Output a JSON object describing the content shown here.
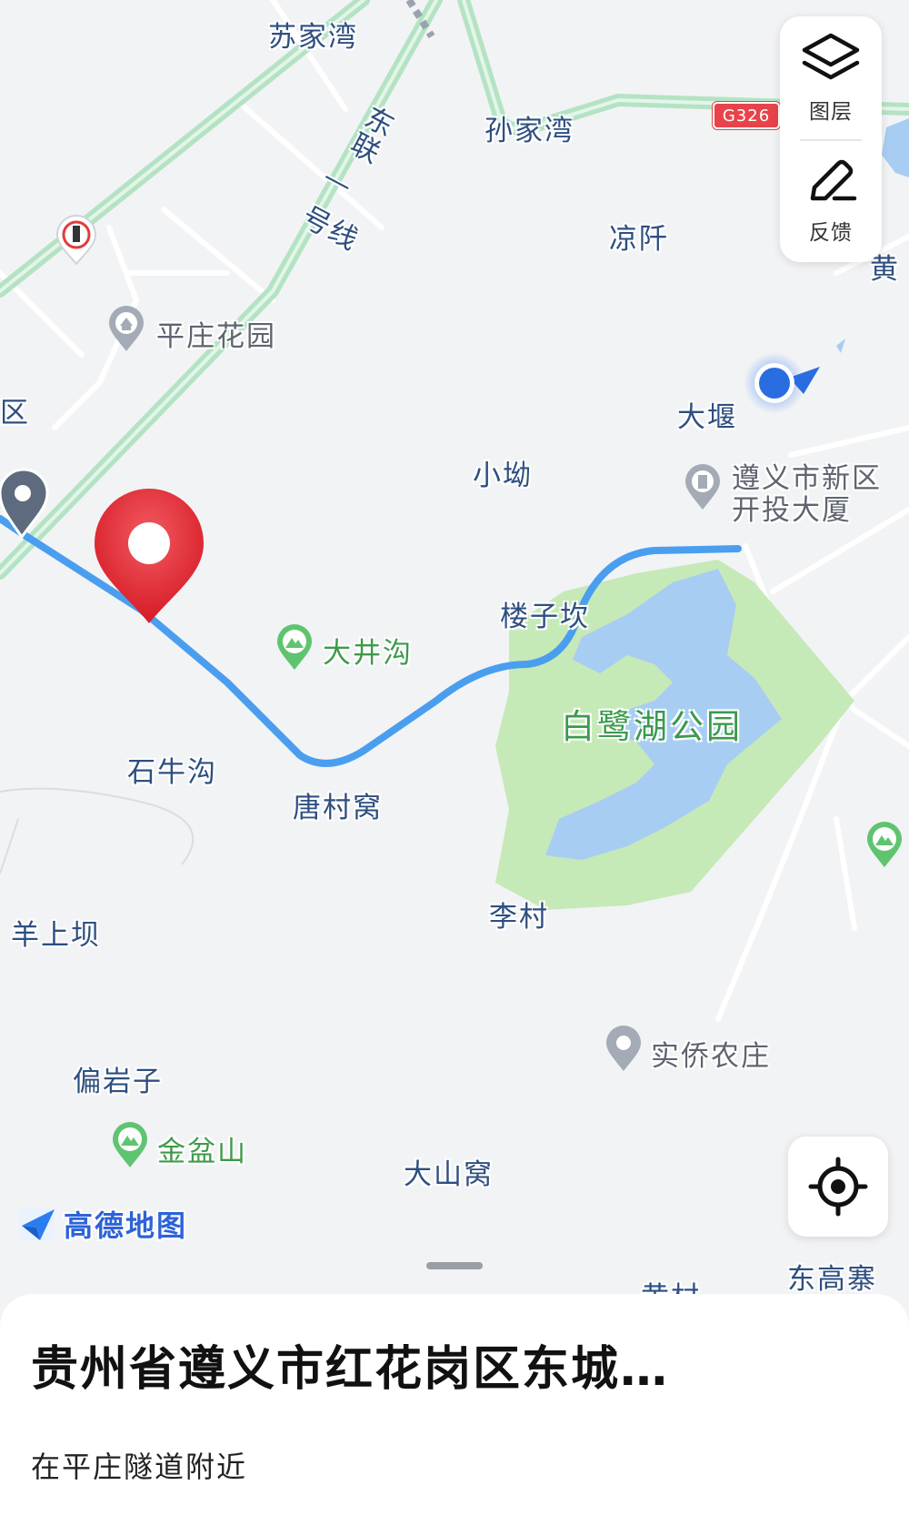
{
  "map": {
    "labels": {
      "sujiawan": "苏家湾",
      "sunjiawan": "孙家湾",
      "liangqian": "凉阡",
      "huang": "黄",
      "dayan": "大堰",
      "xiao_ao": "小坳",
      "lou_zikan": "楼子坎",
      "dajinggou": "大井沟",
      "bailuhu_park": "白鹭湖公园",
      "shiniugou": "石牛沟",
      "tangcunwo": "唐村窝",
      "licun": "李村",
      "yangshangba": "羊上坝",
      "pianyanzi": "偏岩子",
      "jinpenshan": "金盆山",
      "dashanwo": "大山窝",
      "shiqiao_farm": "实侨农庄",
      "donggaozhai": "东高寨",
      "huangcun": "黄村",
      "pingzhuang_garden": "平庄花园",
      "district": "区",
      "kaitou_building_line1": "遵义市新区",
      "kaitou_building_line2": "开投大厦"
    },
    "road_name": "东联线",
    "road_name_partial": "东联",
    "highway_shield": "G326",
    "colors": {
      "route": "#4a9ef0",
      "highway": "#b4e3c3",
      "pin": "#e8343e",
      "water": "#a8cdf3",
      "park": "#c6e9b8",
      "location": "#2a6de0"
    }
  },
  "controls": {
    "layers_label": "图层",
    "feedback_label": "反馈"
  },
  "logo_text": "高德地图",
  "sheet": {
    "title": "贵州省遵义市红花岗区东城…",
    "subtitle": "在平庄隧道附近"
  }
}
